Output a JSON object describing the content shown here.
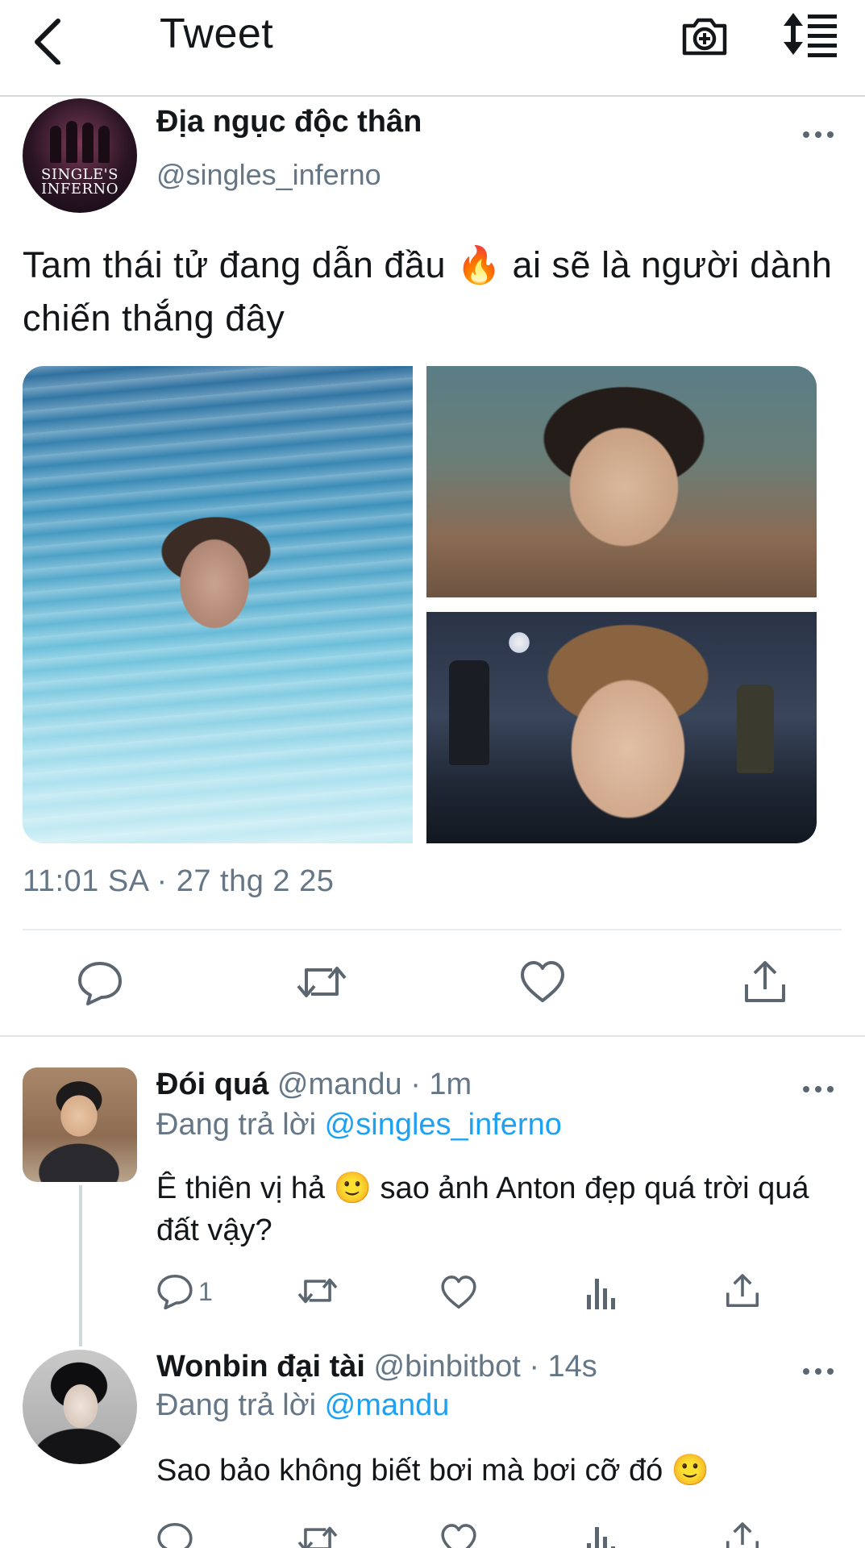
{
  "topbar": {
    "title": "Tweet",
    "icons": [
      "chevron-left-icon",
      "camera-plus-icon",
      "sort-arrows-icon"
    ]
  },
  "tweet": {
    "author": {
      "name": "Địa ngục độc thân",
      "handle": "@singles_inferno",
      "avatar_text": "SINGLE'S INFERNO"
    },
    "text": "Tam thái tử đang dẫn đầu 🔥 ai sẽ là người dành chiến thắng đây",
    "timestamp": "11:01 SA · 27 thg 2 25",
    "actions": [
      "reply-icon",
      "retweet-icon",
      "like-icon",
      "share-icon"
    ]
  },
  "replies": [
    {
      "name": "Đói quá",
      "meta": "@mandu · 1m",
      "replying_prefix": "Đang trả lời",
      "replying_to": "@singles_inferno",
      "text": "Ê thiên vị hả 🙂  sao ảnh Anton đẹp quá trời quá đất vậy?",
      "reply_count": "1"
    },
    {
      "name": "Wonbin đại tài",
      "meta": "@binbitbot · 14s",
      "replying_prefix": "Đang trả lời",
      "replying_to": "@mandu",
      "text": "Sao bảo không biết bơi mà bơi cỡ đó 🙂"
    }
  ],
  "colors": {
    "text": "#14171a",
    "secondary": "#657786",
    "link": "#1da1f2",
    "divider": "#e1e5e8"
  }
}
